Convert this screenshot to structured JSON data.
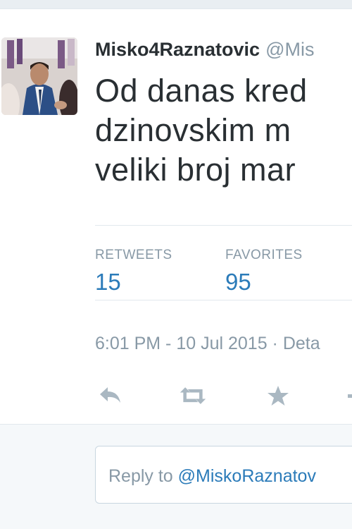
{
  "tweet": {
    "display_name": "Misko4Raznatovic",
    "handle": "@Mis",
    "text_lines": [
      "Od danas kred",
      "dzinovskim m",
      "veliki broj mar"
    ]
  },
  "stats": [
    {
      "label": "RETWEETS",
      "value": "15"
    },
    {
      "label": "FAVORITES",
      "value": "95"
    }
  ],
  "meta": {
    "timestamp": "6:01 PM - 10 Jul 2015",
    "separator": "·",
    "details_link": "Deta"
  },
  "actions": [
    {
      "name": "reply-icon"
    },
    {
      "name": "retweet-icon"
    },
    {
      "name": "favorite-star-icon"
    },
    {
      "name": "more-icon"
    }
  ],
  "reply": {
    "prefix": "Reply to ",
    "mention": "@MiskoRaznatov"
  },
  "colors": {
    "accent": "#2b7bb9",
    "muted": "#8899a6",
    "text": "#292f33",
    "icon": "#aab8c2"
  }
}
